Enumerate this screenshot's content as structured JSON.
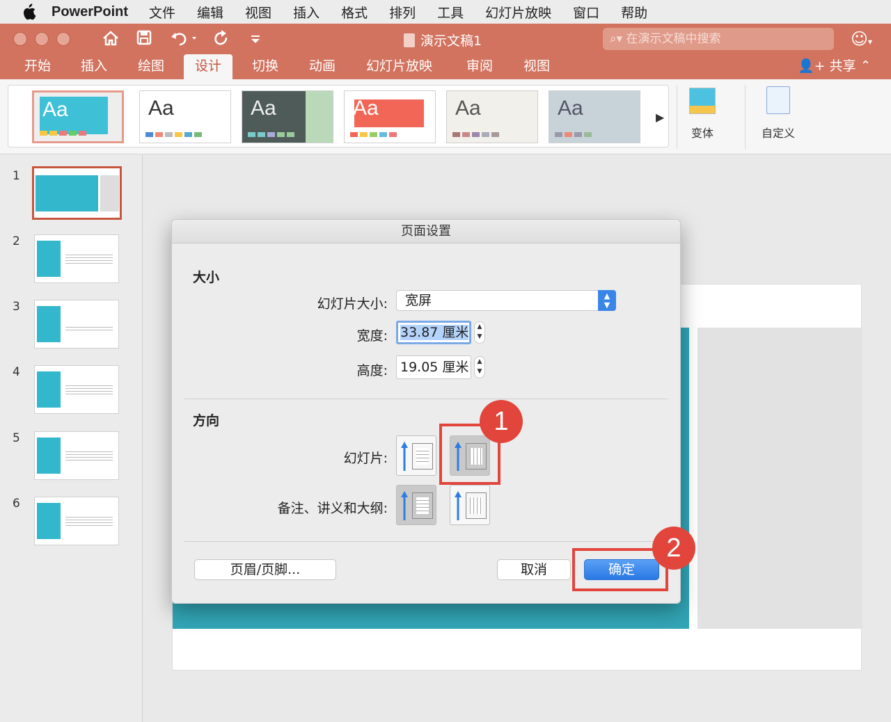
{
  "menubar": {
    "app": "PowerPoint",
    "items": [
      "文件",
      "编辑",
      "视图",
      "插入",
      "格式",
      "排列",
      "工具",
      "幻灯片放映",
      "窗口",
      "帮助"
    ]
  },
  "titlebar": {
    "doc_title": "演示文稿1",
    "search_placeholder": "在演示文稿中搜索"
  },
  "tabs": [
    "开始",
    "插入",
    "绘图",
    "设计",
    "切换",
    "动画",
    "幻灯片放映",
    "审阅",
    "视图"
  ],
  "active_tab": "设计",
  "share_label": "共享",
  "ribbon": {
    "theme_label": "Aa",
    "variants_label": "变体",
    "customize_label": "自定义"
  },
  "thumbnails": [
    "1",
    "2",
    "3",
    "4",
    "5",
    "6"
  ],
  "dialog": {
    "title": "页面设置",
    "size_section": "大小",
    "slide_size_label": "幻灯片大小:",
    "slide_size_value": "宽屏",
    "width_label": "宽度:",
    "width_value": "33.87 厘米",
    "height_label": "高度:",
    "height_value": "19.05 厘米",
    "orientation_section": "方向",
    "slides_label": "幻灯片:",
    "notes_label": "备注、讲义和大纲:",
    "header_footer_button": "页眉/页脚...",
    "cancel_button": "取消",
    "ok_button": "确定"
  },
  "annotations": [
    "1",
    "2"
  ],
  "colors": {
    "accent": "#d2735f",
    "highlight": "#e2453c",
    "primary_button": "#2a78e4",
    "slide_teal": "#32a6b6"
  }
}
